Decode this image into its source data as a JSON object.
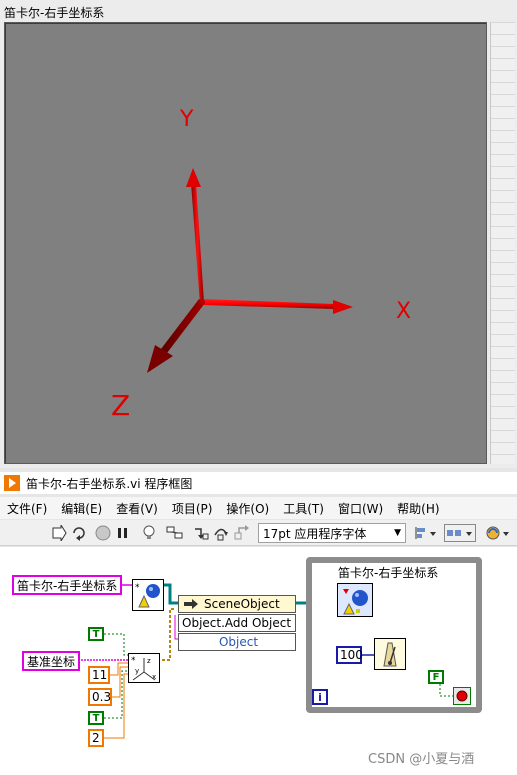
{
  "front_panel": {
    "title": "笛卡尔-右手坐标系",
    "axes": {
      "x_label": "X",
      "y_label": "Y",
      "z_label": "Z"
    },
    "colors": {
      "axis": "#d40000",
      "background": "#808080"
    }
  },
  "block_diagram": {
    "window_title": "笛卡尔-右手坐标系.vi 程序框图",
    "menu": [
      "文件(F)",
      "编辑(E)",
      "查看(V)",
      "项目(P)",
      "操作(O)",
      "工具(T)",
      "窗口(W)",
      "帮助(H)"
    ],
    "toolbar": {
      "font": "17pt 应用程序字体",
      "icons": [
        "run-arrow-icon",
        "run-continuous-icon",
        "abort-icon",
        "pause-icon",
        "highlight-bulb-icon",
        "probe-icon",
        "step-into-icon",
        "step-over-icon",
        "step-out-icon",
        "align-icon",
        "distribute-icon",
        "reorder-icon"
      ]
    },
    "controls": {
      "scene_ref_label": "笛卡尔-右手坐标系",
      "base_coord_label": "基准坐标"
    },
    "constants": {
      "bool_true_1": "T",
      "bool_true_2": "T",
      "bool_false": "F",
      "num_11": "11",
      "num_03": "0.3",
      "num_2": "2",
      "wait_ms": "100"
    },
    "property_node": {
      "class": "SceneObject",
      "method": "Object.Add Object",
      "param": "Object"
    },
    "loop": {
      "label": "笛卡尔-右手坐标系",
      "iteration": "i"
    },
    "colors": {
      "control_border": "#e100e1",
      "bool": "#007a00",
      "i32": "#1a1aa8",
      "dbl": "#f07800"
    }
  },
  "watermark": "CSDN @小夏与酒"
}
